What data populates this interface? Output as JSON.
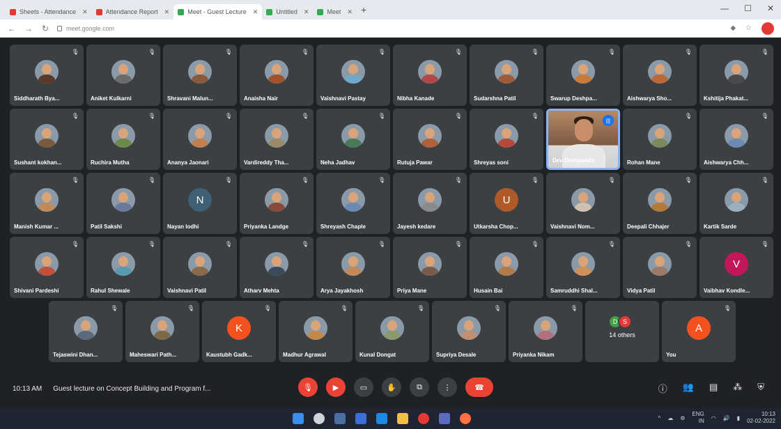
{
  "browser": {
    "tabs": [
      {
        "label": "Sheets - Attendance",
        "favicon_color": "#e53935"
      },
      {
        "label": "Attendance Report",
        "favicon_color": "#e53935"
      },
      {
        "label": "Meet - Guest Lecture",
        "favicon_color": "#34a853",
        "active": true
      },
      {
        "label": "Untitled",
        "favicon_color": "#34a853"
      },
      {
        "label": "Meet",
        "favicon_color": "#34a853"
      }
    ],
    "url": "meet.google.com"
  },
  "meeting": {
    "time": "10:13 AM",
    "title": "Guest lecture on Concept Building and Program f...",
    "others_label": "14 others"
  },
  "participants_rows": [
    [
      {
        "name": "Siddharath Bya...",
        "color": "#5b3a2a"
      },
      {
        "name": "Aniket Kulkarni",
        "color": "#6b6b6b"
      },
      {
        "name": "Shravani Malun...",
        "color": "#8a5a3c"
      },
      {
        "name": "Anaisha Nair",
        "color": "#a0522d"
      },
      {
        "name": "Vaishnavi Pastay",
        "color": "#6fa8c9"
      },
      {
        "name": "Nibha Kanade",
        "color": "#b04a4a"
      },
      {
        "name": "Sudarshna Patil",
        "color": "#9c5b3b"
      },
      {
        "name": "Swarup Deshpa...",
        "color": "#c87a3a"
      },
      {
        "name": "Aishwarya Sho...",
        "color": "#b86a3a"
      },
      {
        "name": "Kshitija Phakat...",
        "color": "#4a4a4a"
      }
    ],
    [
      {
        "name": "Sushant kokhan...",
        "color": "#7a5a3c"
      },
      {
        "name": "Ruchira Mutha",
        "color": "#6b8a4a"
      },
      {
        "name": "Ananya Jaonari",
        "color": "#c08050"
      },
      {
        "name": "Vardireddy Tha...",
        "color": "#9a8a6a"
      },
      {
        "name": "Neha Jadhav",
        "color": "#4a7a5a"
      },
      {
        "name": "Rutuja Pawar",
        "color": "#b0603a"
      },
      {
        "name": "Shreyas soni",
        "color": "#b54a3a"
      },
      {
        "name": "Dev Deshpande",
        "color": "#8a6b55",
        "speaking": true
      },
      {
        "name": "Rohan Mane",
        "color": "#7a8a5a"
      },
      {
        "name": "Aishwarya Chh...",
        "color": "#6a8ab0"
      }
    ],
    [
      {
        "name": "Manish Kumar ...",
        "color": "#c08a5a"
      },
      {
        "name": "Patil Sakshi",
        "color": "#6a7a9a"
      },
      {
        "name": "Nayan lodhi",
        "initial": "N",
        "color": "#3f5f74"
      },
      {
        "name": "Priyanka Landge",
        "color": "#8a4a3a"
      },
      {
        "name": "Shreyash Chaple",
        "color": "#6a8ab0"
      },
      {
        "name": "Jayesh kedare",
        "color": "#8a8a8a"
      },
      {
        "name": "Utkarsha Chop...",
        "initial": "U",
        "color": "#b05a2a"
      },
      {
        "name": "Vaishnavi Nom...",
        "color": "#d0c0b0"
      },
      {
        "name": "Deepali Chhajer",
        "color": "#b07a3a"
      },
      {
        "name": "Kartik Sarde",
        "color": "#9ab0c0"
      }
    ],
    [
      {
        "name": "Shivani Pardeshi",
        "color": "#c0503a"
      },
      {
        "name": "Rahul Shewale",
        "color": "#5a9ab0"
      },
      {
        "name": "Vaishnavi Patil",
        "color": "#8a6a4a"
      },
      {
        "name": "Atharv Mehta",
        "color": "#3a4a5a"
      },
      {
        "name": "Arya Jayakhosh",
        "color": "#c08a5a"
      },
      {
        "name": "Priya Mane",
        "color": "#7a5a4a"
      },
      {
        "name": "Husain Bai",
        "color": "#b07a4a"
      },
      {
        "name": "Samruddhi Shal...",
        "color": "#d0905a"
      },
      {
        "name": "Vidya Patil",
        "color": "#9a7a6a"
      },
      {
        "name": "Vaibhav Kondle...",
        "initial": "V",
        "color": "#c2185b"
      }
    ],
    [
      {
        "name": "Tejaswini Dhan...",
        "color": "#5a6a7a"
      },
      {
        "name": "Maheswari Path...",
        "color": "#7a6a4a"
      },
      {
        "name": "Kaustubh Gadk...",
        "initial": "K",
        "color": "#f4511e"
      },
      {
        "name": "Madhur Agrawal",
        "color": "#c08a4a"
      },
      {
        "name": "Kunal Dongat",
        "color": "#8a9a6a"
      },
      {
        "name": "Supriya Desale",
        "color": "#c09070"
      },
      {
        "name": "Priyanka Nikam",
        "color": "#b07080"
      },
      {
        "name": "",
        "others": true
      },
      {
        "name": "You",
        "initial": "A",
        "color": "#f4511e"
      }
    ]
  ],
  "others_minis": [
    {
      "initial": "D",
      "color": "#43a047"
    },
    {
      "initial": "S",
      "color": "#e53935"
    }
  ],
  "taskbar": {
    "lang": "ENG",
    "region": "IN",
    "time": "10:13",
    "date": "02-02-2022"
  }
}
